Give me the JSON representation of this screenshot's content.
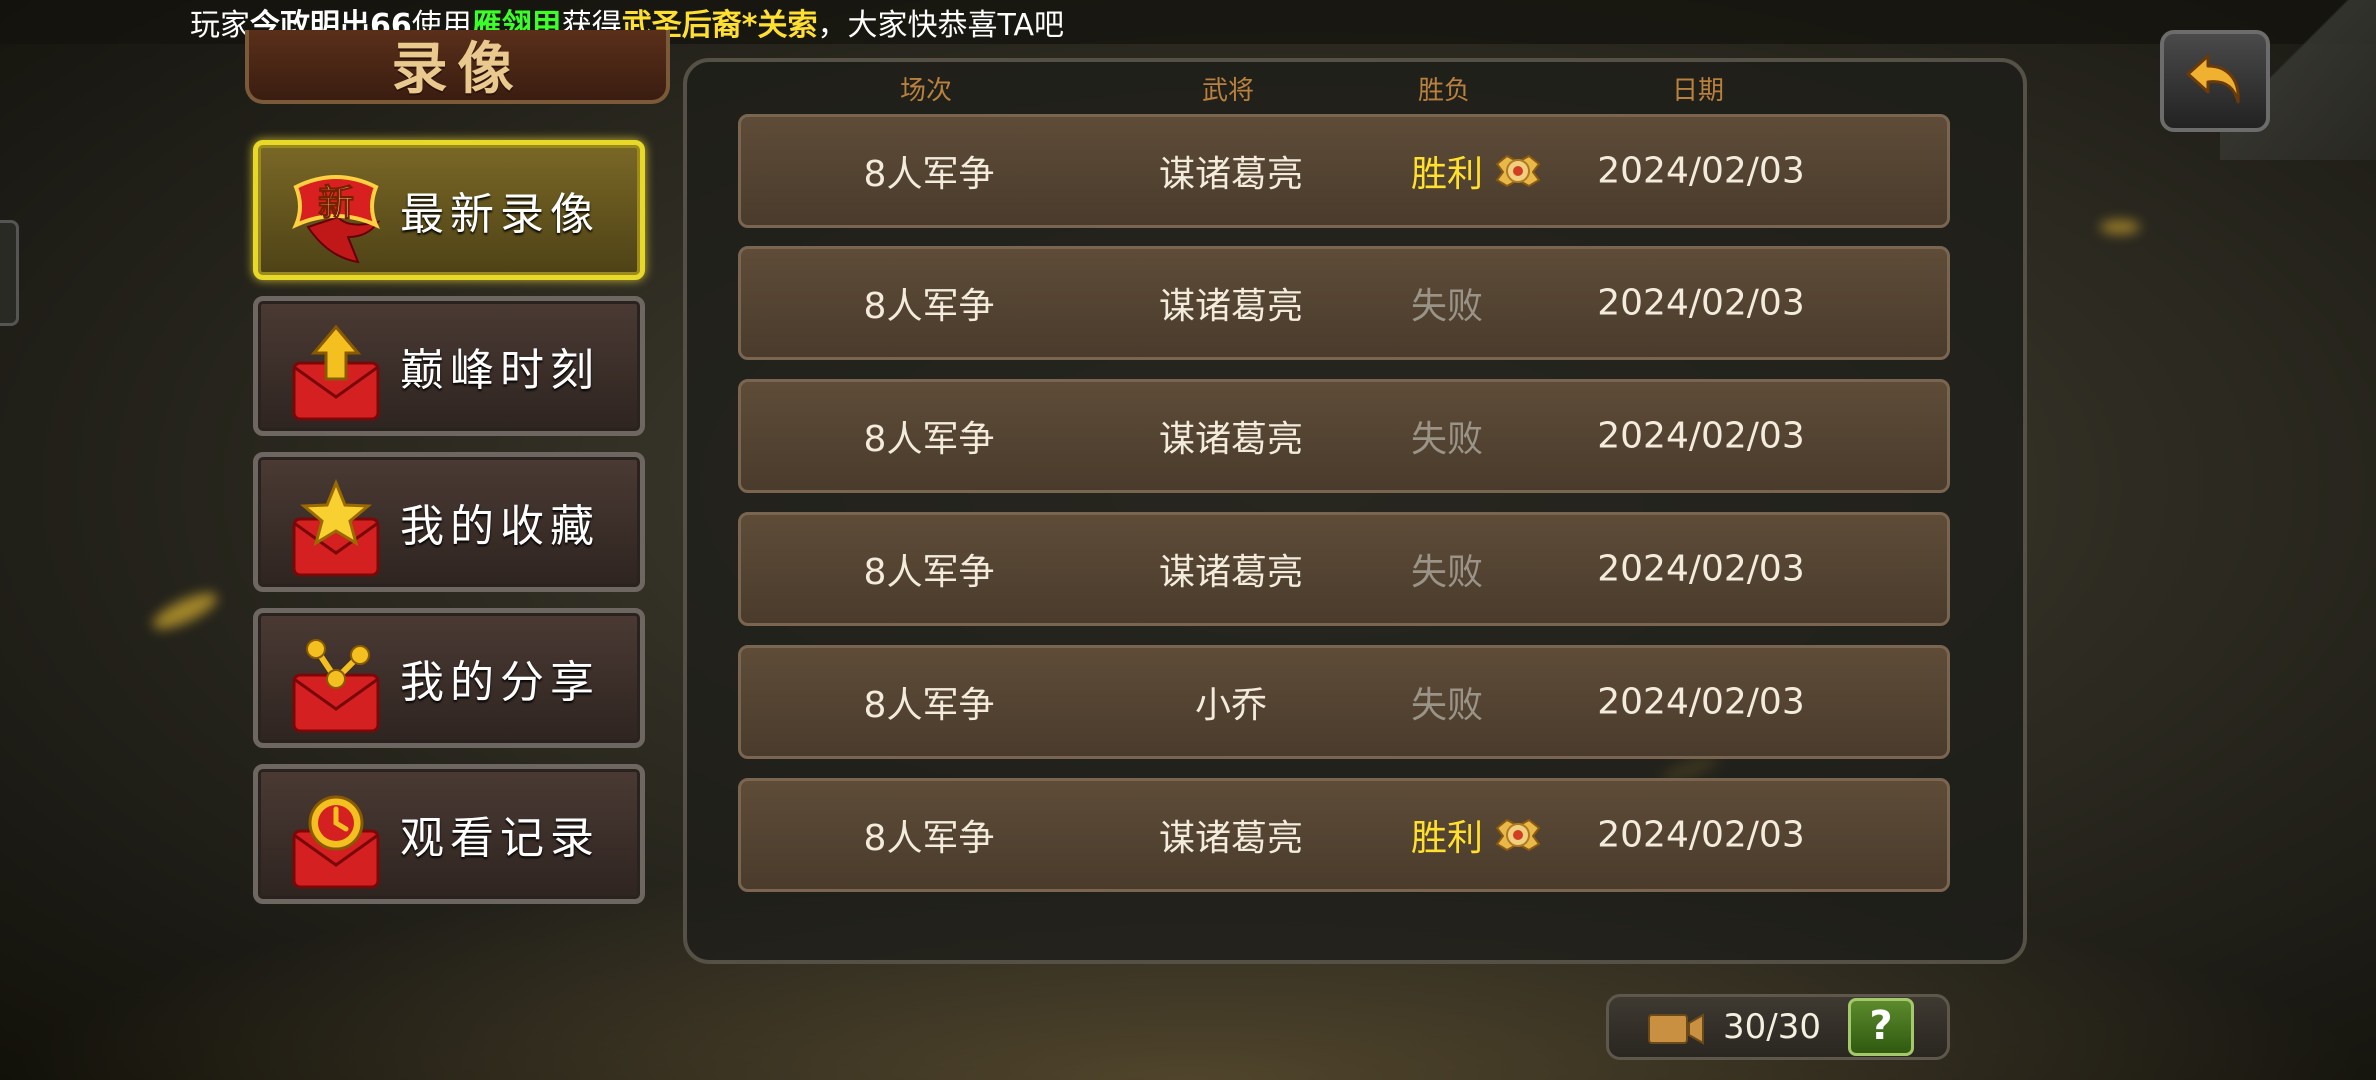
{
  "broadcast": {
    "parts": [
      {
        "text": "玩家",
        "style": "plain"
      },
      {
        "text": "今政明出66",
        "style": "bold"
      },
      {
        "text": "使用",
        "style": "plain"
      },
      {
        "text": "雁翎甲",
        "style": "green"
      },
      {
        "text": " 获得",
        "style": "plain"
      },
      {
        "text": "武圣后裔*关索",
        "style": "yellow"
      },
      {
        "text": "，大家快恭喜TA吧",
        "style": "plain"
      }
    ]
  },
  "title": "录像",
  "sidebar": {
    "items": [
      {
        "label": "最新录像",
        "icon": "new-ribbon-icon",
        "active": true
      },
      {
        "label": "巅峰时刻",
        "icon": "envelope-arrow-icon",
        "active": false
      },
      {
        "label": "我的收藏",
        "icon": "envelope-star-icon",
        "active": false
      },
      {
        "label": "我的分享",
        "icon": "envelope-share-icon",
        "active": false
      },
      {
        "label": "观看记录",
        "icon": "envelope-clock-icon",
        "active": false
      }
    ]
  },
  "table": {
    "headers": [
      "场次",
      "武将",
      "胜负",
      "日期"
    ],
    "rows": [
      {
        "mode": "8人军争",
        "general": "谋诸葛亮",
        "result": "胜利",
        "win": true,
        "date": "2024/02/03"
      },
      {
        "mode": "8人军争",
        "general": "谋诸葛亮",
        "result": "失败",
        "win": false,
        "date": "2024/02/03"
      },
      {
        "mode": "8人军争",
        "general": "谋诸葛亮",
        "result": "失败",
        "win": false,
        "date": "2024/02/03"
      },
      {
        "mode": "8人军争",
        "general": "谋诸葛亮",
        "result": "失败",
        "win": false,
        "date": "2024/02/03"
      },
      {
        "mode": "8人军争",
        "general": "小乔",
        "result": "失败",
        "win": false,
        "date": "2024/02/03"
      },
      {
        "mode": "8人军争",
        "general": "谋诸葛亮",
        "result": "胜利",
        "win": true,
        "date": "2024/02/03"
      }
    ]
  },
  "footer": {
    "count": "30/30",
    "help_label": "?"
  },
  "colors": {
    "win": "#ffe02a",
    "lose": "#9a9488",
    "active_border": "#e8d828",
    "header": "#b9803e"
  }
}
